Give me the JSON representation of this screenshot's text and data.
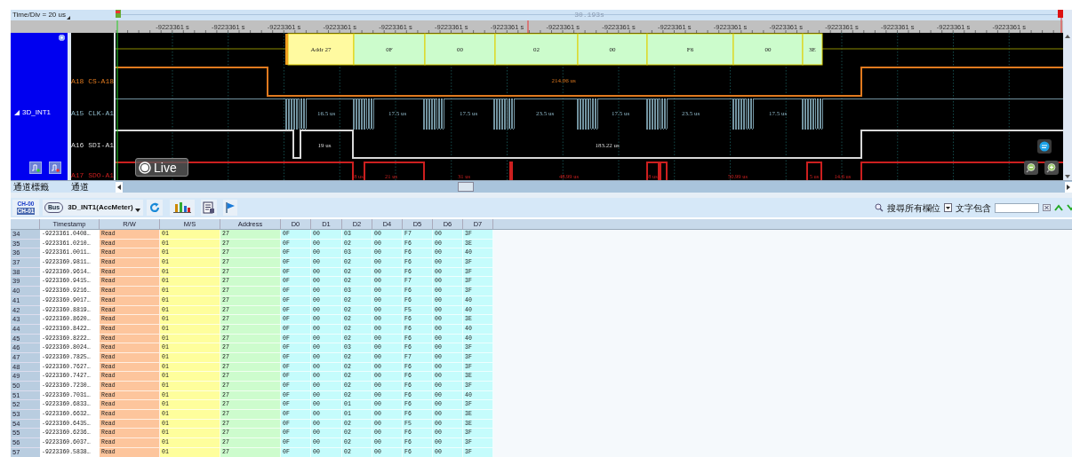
{
  "top_bar": {
    "time_div": "Time/Div = 20 us",
    "cursor_time": "30.193s"
  },
  "ruler": {
    "ticks": [
      "-9223361 s",
      "-9223361 s",
      "-9223361 s",
      "-9223361 s",
      "-9223361 s",
      "-9223361 s",
      "-9223361 s",
      "-9223361 s",
      "-9223361 s",
      "-9223361 s",
      "-9223361 s",
      "-9223361 s",
      "-9223361 s",
      "-9223361 s",
      "-9223361 s",
      "-9223361 s"
    ]
  },
  "channel_group": {
    "name": "3D_INT1",
    "expanded": true
  },
  "bus": {
    "segments": [
      {
        "kind": "address",
        "label": "Addr 27"
      },
      {
        "kind": "data",
        "label": "0F"
      },
      {
        "kind": "data",
        "label": "00"
      },
      {
        "kind": "data",
        "label": "02"
      },
      {
        "kind": "data",
        "label": "00"
      },
      {
        "kind": "data",
        "label": "F6"
      },
      {
        "kind": "data",
        "label": "00"
      },
      {
        "kind": "data",
        "label": "3E"
      }
    ]
  },
  "channels": [
    {
      "label": "A18 CS-A18",
      "color": "#e07a1f",
      "timings": [
        "214.06 us"
      ]
    },
    {
      "label": "A15 CLK-A1",
      "color": "#8fb8c8",
      "timings": [
        "16.5 us",
        "17.5 us",
        "17.5 us",
        "23.5 us",
        "17.5 us",
        "23.5 us",
        "17.5 us"
      ]
    },
    {
      "label": "A16 SDI-A1",
      "color": "#d8d8d8",
      "timings": [
        "19 us",
        "183.22 us"
      ]
    },
    {
      "label": "A17 SDO-A1",
      "color": "#cc1f1f",
      "timings": [
        "8 us",
        "21 us",
        "31 us",
        "48.99 us",
        "8 us",
        "50.99 us",
        "5 us",
        "14.6 us"
      ]
    }
  ],
  "live_button": "Live",
  "bottom_bar": {
    "label_column": "通道標籤",
    "channel_column": "通道"
  },
  "toolbar": {
    "channel_top": "CH-00",
    "channel_bottom": "CH-01",
    "bus_label": "Bus",
    "bus_name": "3D_INT1(AccMeter)",
    "search_scope": "搜尋所有欄位",
    "match_mode": "文字包含"
  },
  "table": {
    "columns": [
      "Timestamp",
      "R/W",
      "M/S",
      "Address",
      "D0",
      "D1",
      "D2",
      "D4",
      "D5",
      "D6",
      "D7"
    ],
    "rows": [
      {
        "index": "34",
        "cells": [
          "-9223361.0408…",
          "Read",
          "01",
          "27",
          "0F",
          "00",
          "03",
          "00",
          "F7",
          "00",
          "3F"
        ]
      },
      {
        "index": "35",
        "cells": [
          "-9223361.0210…",
          "Read",
          "01",
          "27",
          "0F",
          "00",
          "02",
          "00",
          "F6",
          "00",
          "3E"
        ]
      },
      {
        "index": "36",
        "cells": [
          "-9223361.0011…",
          "Read",
          "01",
          "27",
          "0F",
          "00",
          "03",
          "00",
          "F6",
          "00",
          "40"
        ]
      },
      {
        "index": "37",
        "cells": [
          "-9223360.9811…",
          "Read",
          "01",
          "27",
          "0F",
          "00",
          "02",
          "00",
          "F6",
          "00",
          "3F"
        ]
      },
      {
        "index": "38",
        "cells": [
          "-9223360.9614…",
          "Read",
          "01",
          "27",
          "0F",
          "00",
          "02",
          "00",
          "F6",
          "00",
          "3F"
        ]
      },
      {
        "index": "39",
        "cells": [
          "-9223360.9415…",
          "Read",
          "01",
          "27",
          "0F",
          "00",
          "02",
          "00",
          "F7",
          "00",
          "3F"
        ]
      },
      {
        "index": "40",
        "cells": [
          "-9223360.9216…",
          "Read",
          "01",
          "27",
          "0F",
          "00",
          "03",
          "00",
          "F6",
          "00",
          "3F"
        ]
      },
      {
        "index": "41",
        "cells": [
          "-9223360.9017…",
          "Read",
          "01",
          "27",
          "0F",
          "00",
          "02",
          "00",
          "F6",
          "00",
          "40"
        ]
      },
      {
        "index": "42",
        "cells": [
          "-9223360.8819…",
          "Read",
          "01",
          "27",
          "0F",
          "00",
          "02",
          "00",
          "F5",
          "00",
          "40"
        ]
      },
      {
        "index": "43",
        "cells": [
          "-9223360.8620…",
          "Read",
          "01",
          "27",
          "0F",
          "00",
          "02",
          "00",
          "F6",
          "00",
          "3E"
        ]
      },
      {
        "index": "44",
        "cells": [
          "-9223360.8422…",
          "Read",
          "01",
          "27",
          "0F",
          "00",
          "02",
          "00",
          "F6",
          "00",
          "40"
        ]
      },
      {
        "index": "45",
        "cells": [
          "-9223360.8222…",
          "Read",
          "01",
          "27",
          "0F",
          "00",
          "02",
          "00",
          "F6",
          "00",
          "40"
        ]
      },
      {
        "index": "46",
        "cells": [
          "-9223360.8024…",
          "Read",
          "01",
          "27",
          "0F",
          "00",
          "03",
          "00",
          "F6",
          "00",
          "3F"
        ]
      },
      {
        "index": "47",
        "cells": [
          "-9223360.7825…",
          "Read",
          "01",
          "27",
          "0F",
          "00",
          "02",
          "00",
          "F7",
          "00",
          "3F"
        ]
      },
      {
        "index": "48",
        "cells": [
          "-9223360.7627…",
          "Read",
          "01",
          "27",
          "0F",
          "00",
          "02",
          "00",
          "F6",
          "00",
          "3F"
        ]
      },
      {
        "index": "49",
        "cells": [
          "-9223360.7427…",
          "Read",
          "01",
          "27",
          "0F",
          "00",
          "02",
          "00",
          "F6",
          "00",
          "3E"
        ]
      },
      {
        "index": "50",
        "cells": [
          "-9223360.7230…",
          "Read",
          "01",
          "27",
          "0F",
          "00",
          "02",
          "00",
          "F6",
          "00",
          "3F"
        ]
      },
      {
        "index": "51",
        "cells": [
          "-9223360.7031…",
          "Read",
          "01",
          "27",
          "0F",
          "00",
          "02",
          "00",
          "F6",
          "00",
          "40"
        ]
      },
      {
        "index": "52",
        "cells": [
          "-9223360.6833…",
          "Read",
          "01",
          "27",
          "0F",
          "00",
          "01",
          "00",
          "F6",
          "00",
          "3F"
        ]
      },
      {
        "index": "53",
        "cells": [
          "-9223360.6632…",
          "Read",
          "01",
          "27",
          "0F",
          "00",
          "01",
          "00",
          "F6",
          "00",
          "3E"
        ]
      },
      {
        "index": "54",
        "cells": [
          "-9223360.6435…",
          "Read",
          "01",
          "27",
          "0F",
          "00",
          "02",
          "00",
          "F5",
          "00",
          "3E"
        ]
      },
      {
        "index": "55",
        "cells": [
          "-9223360.6236…",
          "Read",
          "01",
          "27",
          "0F",
          "00",
          "02",
          "00",
          "F6",
          "00",
          "3F"
        ]
      },
      {
        "index": "56",
        "cells": [
          "-9223360.6037…",
          "Read",
          "01",
          "27",
          "0F",
          "00",
          "02",
          "00",
          "F6",
          "00",
          "3F"
        ]
      },
      {
        "index": "57",
        "cells": [
          "-9223360.5838…",
          "Read",
          "01",
          "27",
          "0F",
          "00",
          "02",
          "00",
          "F6",
          "00",
          "3F"
        ]
      }
    ]
  }
}
